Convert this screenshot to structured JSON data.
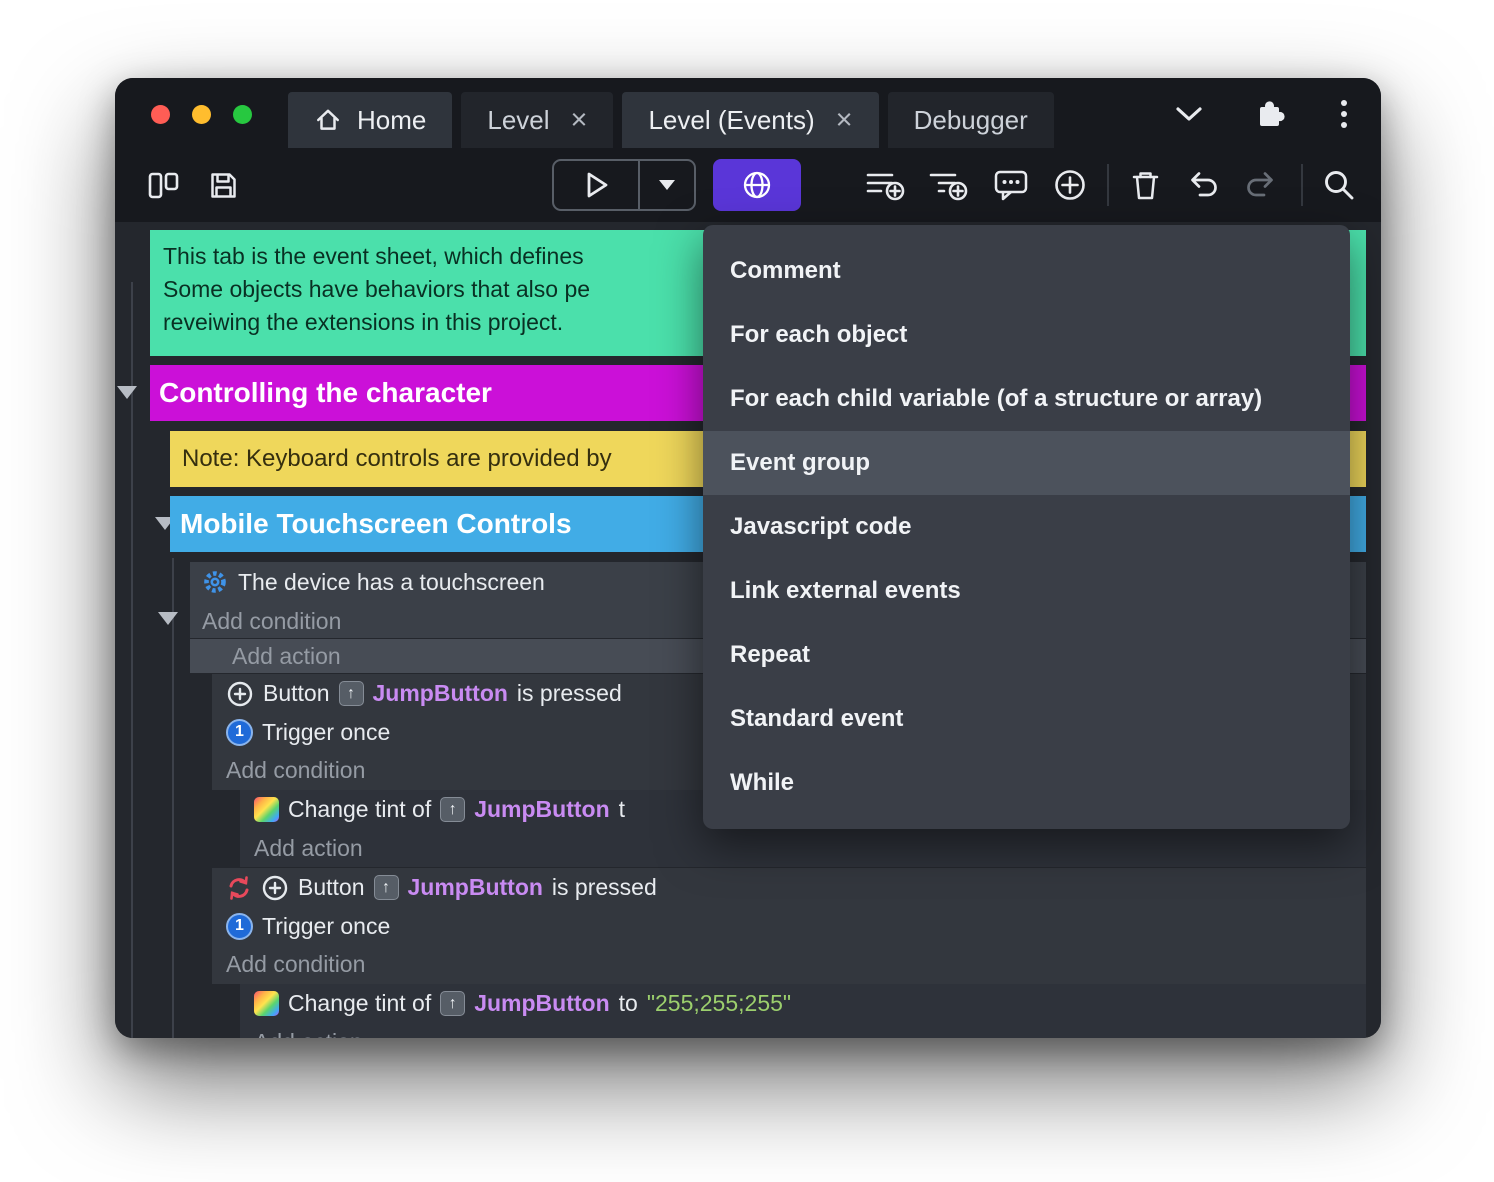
{
  "titlebar": {
    "tabs": [
      {
        "label": "Home"
      },
      {
        "label": "Level"
      },
      {
        "label": "Level (Events)"
      },
      {
        "label": "Debugger"
      }
    ],
    "close_glyph": "×"
  },
  "context_menu": {
    "items": [
      "Comment",
      "For each object",
      "For each child variable (of a structure or array)",
      "Event group",
      "Javascript code",
      "Link external events",
      "Repeat",
      "Standard event",
      "While"
    ],
    "highlighted": "Event group"
  },
  "sheet": {
    "comment_lines": [
      "This tab is the event sheet, which defines",
      "Some objects have behaviors that also pe",
      "reveiwing the extensions in this project."
    ],
    "group_character": "Controlling the character",
    "note_keyboard": "Note: Keyboard controls are provided by",
    "group_mobile": "Mobile Touchscreen Controls",
    "touchscreen_condition": "The device has a touchscreen",
    "add_condition": "Add condition",
    "add_action": "Add action",
    "button_label": "Button",
    "object_name": "JumpButton",
    "is_pressed": "is pressed",
    "trigger_once": "Trigger once",
    "change_tint_of": "Change tint of",
    "truncated_to": "t",
    "to_word": "to",
    "tint_value": "\"255;255;255\"",
    "chip_glyph": "↑",
    "once_glyph": "1"
  },
  "colors": {
    "comment_bg": "#4be0ab",
    "group_character_bg": "#cb10d8",
    "note_bg": "#efd75b",
    "group_mobile_bg": "#41ace6",
    "selected_tool_bg": "#5a36d8",
    "object_text": "#c98bf2",
    "string_text": "#9ccf6d",
    "menu_highlight": "#4c525c"
  }
}
